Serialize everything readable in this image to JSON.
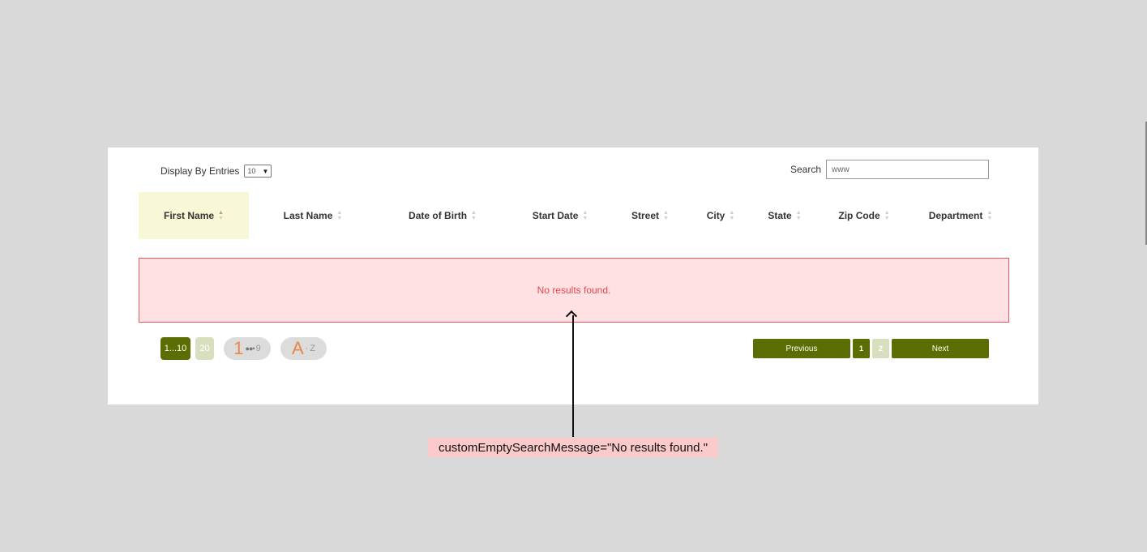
{
  "controls": {
    "entries_label": "Display By Entries",
    "entries_value": "10",
    "search_label": "Search",
    "search_value": "www"
  },
  "columns": [
    {
      "label": "First Name",
      "sorted": "asc"
    },
    {
      "label": "Last Name"
    },
    {
      "label": "Date of Birth"
    },
    {
      "label": "Start Date"
    },
    {
      "label": "Street"
    },
    {
      "label": "City"
    },
    {
      "label": "State"
    },
    {
      "label": "Zip Code"
    },
    {
      "label": "Department"
    }
  ],
  "empty_message": "No results found.",
  "view_options": {
    "range_label": "1...10",
    "page_size_label": "20",
    "numeric_sort": {
      "big": "1",
      "small": "9"
    },
    "alpha_sort": {
      "big": "A",
      "small": "Z"
    }
  },
  "pagination": {
    "previous_label": "Previous",
    "pages": [
      "1",
      "2"
    ],
    "current_page": "1",
    "next_label": "Next"
  },
  "annotation": "customEmptySearchMessage=\"No results found.\"",
  "colors": {
    "background": "#d9d9d9",
    "accent": "#5b6e04",
    "accent_light": "#d7dfbe",
    "active_header": "#f8f8d6",
    "empty_bg": "#ffe1e3",
    "empty_border": "#e25a5e",
    "empty_text": "#e0484e",
    "annotation_bg": "#fbcaca"
  }
}
